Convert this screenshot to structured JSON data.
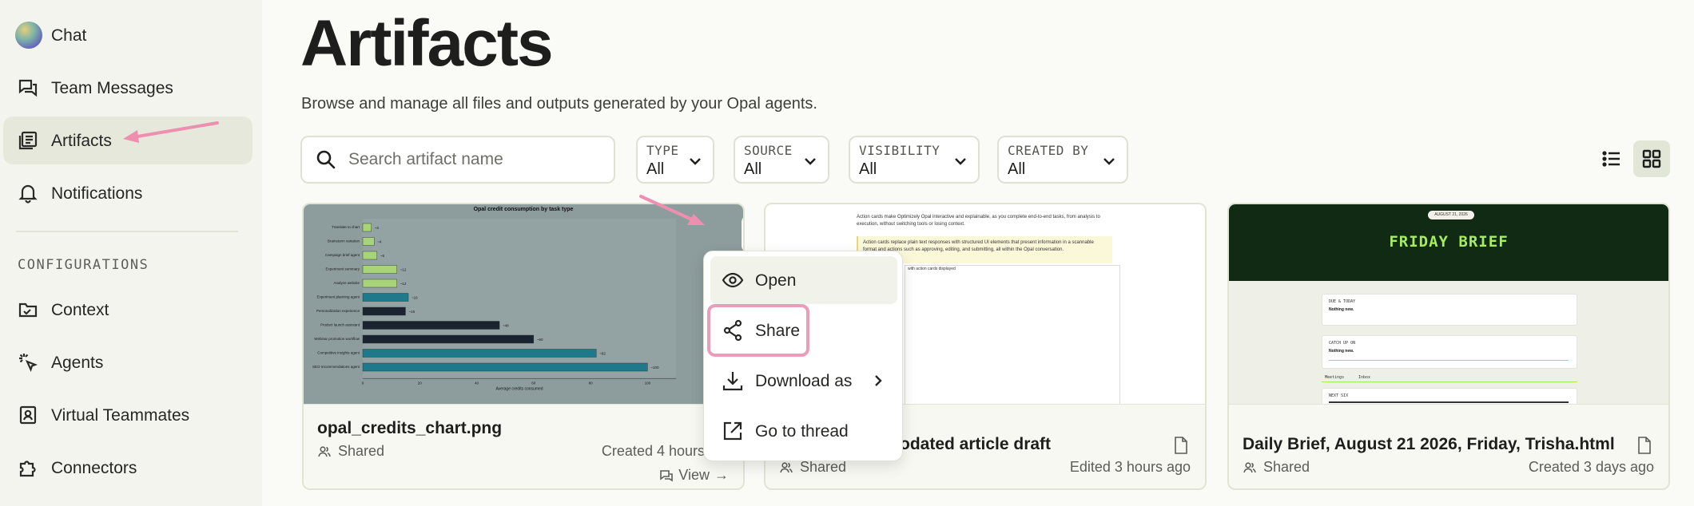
{
  "sidebar": {
    "items": [
      {
        "label": "Chat",
        "icon": "avatar"
      },
      {
        "label": "Team Messages",
        "icon": "messages-icon"
      },
      {
        "label": "Artifacts",
        "icon": "artifacts-icon",
        "active": true
      },
      {
        "label": "Notifications",
        "icon": "bell-icon"
      }
    ],
    "section_label": "CONFIGURATIONS",
    "config_items": [
      {
        "label": "Context",
        "icon": "folder-icon"
      },
      {
        "label": "Agents",
        "icon": "sparkle-cursor-icon"
      },
      {
        "label": "Virtual Teammates",
        "icon": "teammate-badge-icon"
      },
      {
        "label": "Connectors",
        "icon": "puzzle-icon"
      }
    ]
  },
  "page": {
    "title": "Artifacts",
    "subtitle": "Browse and manage all files and outputs generated by your Opal agents."
  },
  "search": {
    "placeholder": "Search artifact name"
  },
  "filters": [
    {
      "label": "TYPE",
      "value": "All"
    },
    {
      "label": "SOURCE",
      "value": "All"
    },
    {
      "label": "VISIBILITY",
      "value": "All"
    },
    {
      "label": "CREATED BY",
      "value": "All"
    }
  ],
  "view_toggle": {
    "list_icon": "list-icon",
    "grid_icon": "grid-icon",
    "active": "grid"
  },
  "cards": [
    {
      "title": "opal_credits_chart.png",
      "visibility": "Shared",
      "date": "Created 4 hours",
      "view_label": "View",
      "thumb": {
        "chart_title": "Opal credit consumption by task type",
        "bars": [
          {
            "label": "Translate to chart",
            "value": 3
          },
          {
            "label": "Brainstorm variation",
            "value": 4
          },
          {
            "label": "Campaign brief agent",
            "value": 5
          },
          {
            "label": "Experiment summary",
            "value": 12
          },
          {
            "label": "Analyze website",
            "value": 12
          },
          {
            "label": "Experiment planning agent",
            "value": 16
          },
          {
            "label": "Personalization experience",
            "value": 15
          },
          {
            "label": "Product launch assistant",
            "value": 48
          },
          {
            "label": "Webinar promotion workflow",
            "value": 60
          },
          {
            "label": "Competitive insights agent",
            "value": 82
          },
          {
            "label": "SEO recommendations agent",
            "value": 100
          }
        ],
        "x_ticks": [
          "0",
          "20",
          "40",
          "60",
          "80",
          "100"
        ],
        "xlabel": "Average credits consumed"
      }
    },
    {
      "title": "odated article draft",
      "date": "Edited 3 hours ago",
      "visibility": "Shared",
      "thumb": {
        "para1": "Action cards make Optimizely Opal interactive and explainable, as you complete end-to-end tasks, from analysis to execution, without switching tools or losing context.",
        "para2": "Action cards replace plain text responses with structured UI elements that present information in a scannable format and actions such as approving, editing, and submitting, all within the Opal conversation.",
        "caption": "with action cards displayed"
      }
    },
    {
      "title": "Daily Brief, August 21 2026, Friday, Trisha.html",
      "date": "Created 3 days ago",
      "visibility": "Shared",
      "thumb": {
        "pill": "AUGUST 21, 2026",
        "brief_title": "FRIDAY BRIEF",
        "box1_label": "DUE & TODAY",
        "box1_value": "Nothing new.",
        "box2_label": "CATCH UP ON",
        "box2_value": "Nothing new.",
        "tab1": "Meetings",
        "tab2": "Inbox",
        "box3_label": "NEXT SIX"
      }
    }
  ],
  "menu": {
    "items": [
      {
        "label": "Open",
        "icon": "eye-icon"
      },
      {
        "label": "Share",
        "icon": "share-icon"
      },
      {
        "label": "Download as",
        "icon": "download-icon"
      },
      {
        "label": "Go to thread",
        "icon": "external-link-icon"
      }
    ]
  },
  "colors": {
    "highlight_pink": "#ea9cb8",
    "active_nav": "#e6e8dc",
    "bar_green": "#a7d379",
    "bar_teal": "#1e7a8a",
    "bar_dark": "#1a2430",
    "brief_green": "#a7ec5c"
  }
}
